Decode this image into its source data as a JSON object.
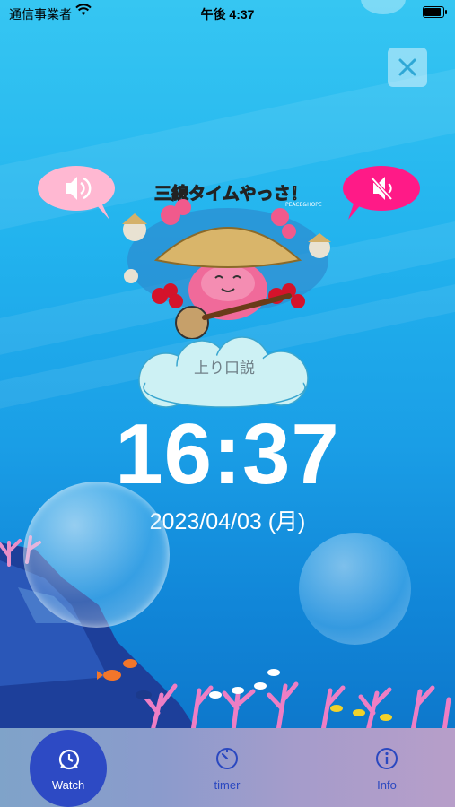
{
  "status_bar": {
    "carrier": "通信事業者",
    "time": "午後 4:37",
    "battery_level": 1.0
  },
  "controls": {
    "close_icon": "close-icon",
    "sound_on_icon": "speaker-on-icon",
    "sound_off_icon": "speaker-mute-icon"
  },
  "banner": {
    "title": "三線タイムやっさ！",
    "badge": "PEACE&HOPE"
  },
  "song": {
    "name": "上り口説"
  },
  "clock": {
    "time": "16:37",
    "date": "2023/04/03 (月)"
  },
  "tabs": [
    {
      "label": "Watch",
      "icon": "alarm-clock-icon",
      "selected": true
    },
    {
      "label": "timer",
      "icon": "timer-icon",
      "selected": false
    },
    {
      "label": "Info",
      "icon": "info-icon",
      "selected": false
    }
  ],
  "colors": {
    "tab_selected": "#2d4ac4",
    "tab_text": "#2a48c0",
    "sound_on_bubble": "#ffb3cf",
    "sound_off_bubble": "#ff1a87"
  }
}
